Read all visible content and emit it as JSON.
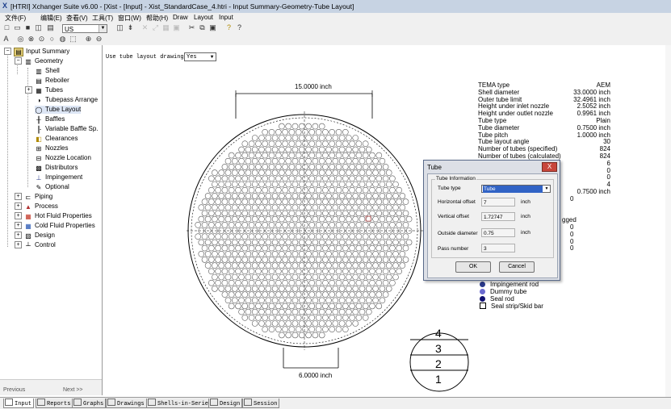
{
  "window": {
    "icon_text": "X",
    "title": "[HTRI] Xchanger Suite v6.00 - [Xist - [Input] - Xist_StandardCase_4.htri - Input Summary-Geometry-Tube Layout]"
  },
  "menu": [
    "文件(F)",
    "编辑(E)",
    "查看(V)",
    "工具(T)",
    "窗口(W)",
    "帮助(H)",
    "Draw",
    "Layout",
    "Input"
  ],
  "toolbar": {
    "units_value": "US"
  },
  "tree": {
    "root": "Input Summary",
    "geometry": "Geometry",
    "geometry_children": [
      "Shell",
      "Reboiler",
      "Tubes",
      "Tubepass Arrange",
      "Tube Layout",
      "Baffles",
      "Variable Baffle Sp.",
      "Clearances",
      "Nozzles",
      "Nozzle Location",
      "Distributors",
      "Impingement",
      "Optional"
    ],
    "others": [
      "Piping",
      "Process",
      "Hot Fluid Properties",
      "Cold Fluid Properties",
      "Design",
      "Control"
    ],
    "bottom_tabs": [
      "Previous",
      "Next >>"
    ]
  },
  "main": {
    "drawing_label": "Use tube layout drawing as",
    "drawing_value": "Yes",
    "top_dimension": "15.0000 inch",
    "bottom_dimension": "6.0000 inch",
    "pass_numbers": [
      "4",
      "3",
      "2",
      "1"
    ]
  },
  "info": [
    {
      "label": "TEMA type",
      "value": "AEM"
    },
    {
      "label": "Shell diameter",
      "value": "33.0000 inch"
    },
    {
      "label": "Outer tube limit",
      "value": "32.4961 inch"
    },
    {
      "label": "Height under inlet nozzle",
      "value": "2.5052 inch"
    },
    {
      "label": "Height under outlet nozzle",
      "value": "0.9961 inch"
    },
    {
      "label": "Tube type",
      "value": "Plain"
    },
    {
      "label": "Tube diameter",
      "value": "0.7500 inch"
    },
    {
      "label": "Tube pitch",
      "value": "1.0000 inch"
    },
    {
      "label": "Tube layout angle",
      "value": "30"
    },
    {
      "label": "Number of tubes (specified)",
      "value": "824"
    },
    {
      "label": "Number of tubes (calculated)",
      "value": "824"
    }
  ],
  "info_partial": [
    {
      "value": "6"
    },
    {
      "value": "0"
    },
    {
      "value": "0"
    },
    {
      "value": "4"
    },
    {
      "value": "0.7500 inch"
    },
    {
      "value": "0"
    },
    {
      "value": "gged"
    },
    {
      "value": "0"
    },
    {
      "value": "0"
    },
    {
      "value": "0"
    },
    {
      "value": "0"
    }
  ],
  "legend": [
    {
      "label": "Impingement rod",
      "color": "#2a3a8a"
    },
    {
      "label": "Dummy tube",
      "color": "#6a6ad0"
    },
    {
      "label": "Seal rod",
      "color": "#101070"
    },
    {
      "label": "Seal strip/Skid bar",
      "color": "#ffffff"
    }
  ],
  "dialog": {
    "title": "Tube",
    "close": "X",
    "group_title": "Tube Information",
    "fields": {
      "tube_type": {
        "label": "Tube type",
        "value": "Tube"
      },
      "horizontal_offset": {
        "label": "Horizontal offset",
        "value": "7",
        "unit": "inch"
      },
      "vertical_offset": {
        "label": "Vertical offset",
        "value": "1.72747",
        "unit": "inch"
      },
      "outside_diameter": {
        "label": "Outside diameter",
        "value": "0.75",
        "unit": "inch"
      },
      "pass_number": {
        "label": "Pass number",
        "value": "3"
      }
    },
    "ok": "OK",
    "cancel": "Cancel"
  },
  "bottom_tabs": [
    "Input",
    "Reports",
    "Graphs",
    "Drawings",
    "Shells-in-Series",
    "Design",
    "Session"
  ],
  "colors": {
    "tube_circle": "#555555",
    "titlebar": "#c7d3e3",
    "selection": "#3163c5",
    "close_button": "#c8463c"
  }
}
